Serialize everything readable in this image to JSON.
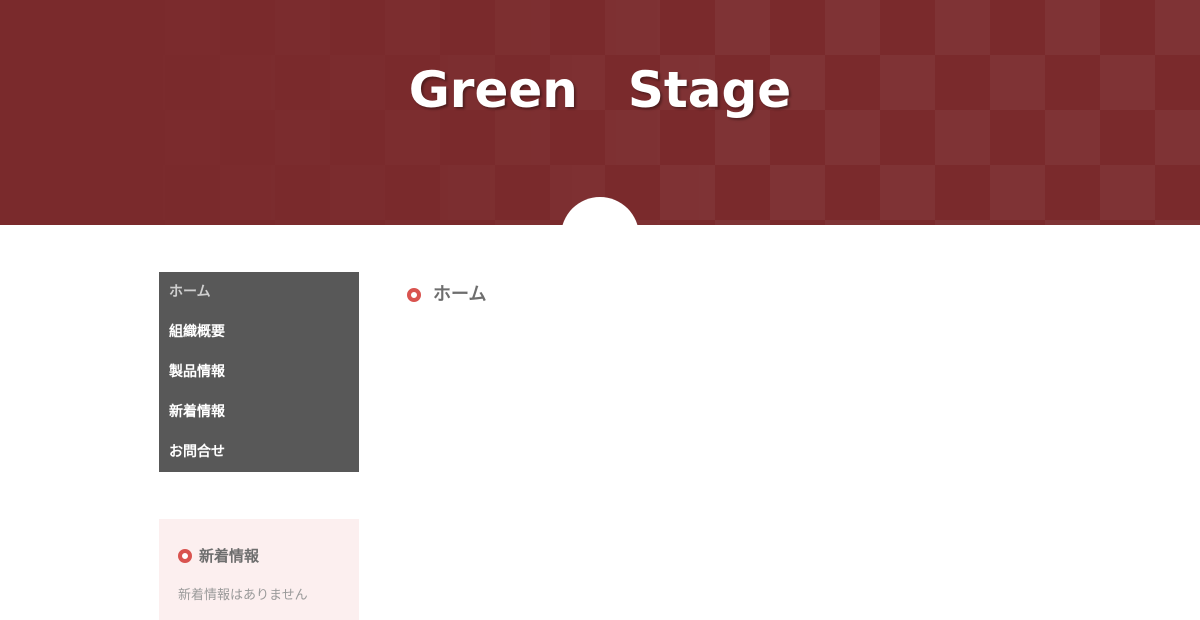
{
  "header": {
    "site_title": "Green　Stage"
  },
  "nav": {
    "items": [
      {
        "label": "ホーム",
        "active": true
      },
      {
        "label": "組織概要",
        "active": false
      },
      {
        "label": "製品情報",
        "active": false
      },
      {
        "label": "新着情報",
        "active": false
      },
      {
        "label": "お問合せ",
        "active": false
      }
    ]
  },
  "widget": {
    "title": "新着情報",
    "empty_text": "新着情報はありません"
  },
  "main": {
    "heading": "ホーム"
  },
  "icons": {
    "heading_marker": "ring-icon"
  },
  "colors": {
    "header_bg": "#7a2a2c",
    "nav_bg": "#585858",
    "accent": "#d9534f",
    "widget_bg": "#fcefef"
  }
}
